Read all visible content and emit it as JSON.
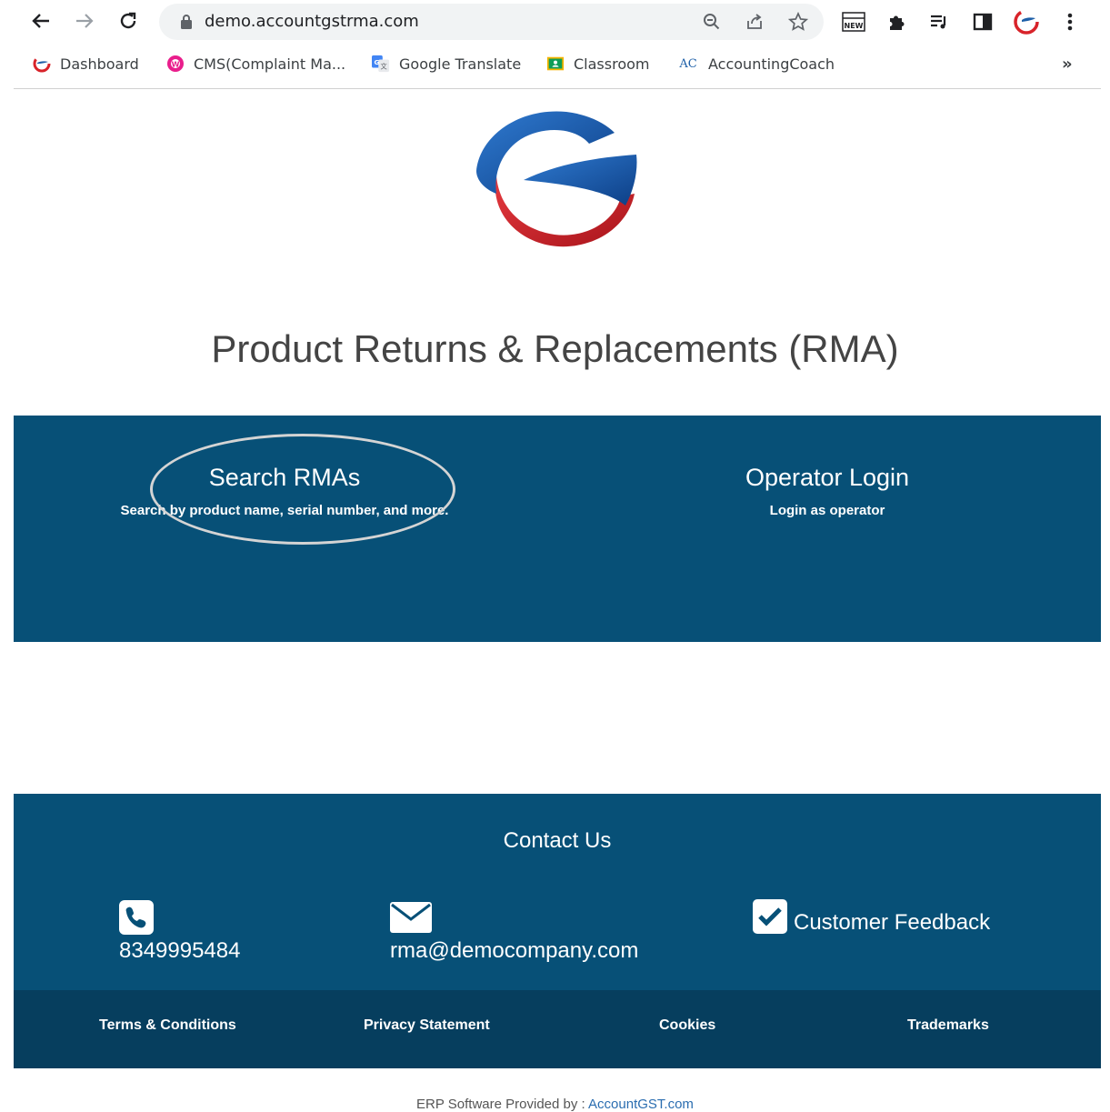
{
  "browser": {
    "url": "demo.accountgstrma.com",
    "bookmarks": [
      {
        "label": "Dashboard",
        "icon": "dashboard-favicon"
      },
      {
        "label": "CMS(Complaint Ma...",
        "icon": "cms-favicon"
      },
      {
        "label": "Google Translate",
        "icon": "google-translate-favicon"
      },
      {
        "label": "Classroom",
        "icon": "classroom-favicon"
      },
      {
        "label": "AccountingCoach",
        "icon": "accountingcoach-favicon",
        "icon_text": "AC"
      }
    ],
    "overflow": "»",
    "extension_badge": "NEW"
  },
  "page": {
    "title": "Product Returns & Replacements (RMA)",
    "hero": {
      "search": {
        "heading": "Search RMAs",
        "sub": "Search by product name, serial number, and more."
      },
      "operator": {
        "heading": "Operator Login",
        "sub": "Login as operator"
      }
    },
    "contact": {
      "title": "Contact Us",
      "phone": "8349995484",
      "email": "rma@democompany.com",
      "feedback": "Customer Feedback"
    },
    "footer_links": [
      "Terms & Conditions",
      "Privacy Statement",
      "Cookies",
      "Trademarks"
    ],
    "provided_prefix": "ERP Software Provided by : ",
    "provided_link": "AccountGST.com"
  },
  "colors": {
    "panel": "#075077",
    "footer": "#063e5e",
    "logo_blue": "#1d5fa8",
    "logo_red": "#d8232a"
  }
}
